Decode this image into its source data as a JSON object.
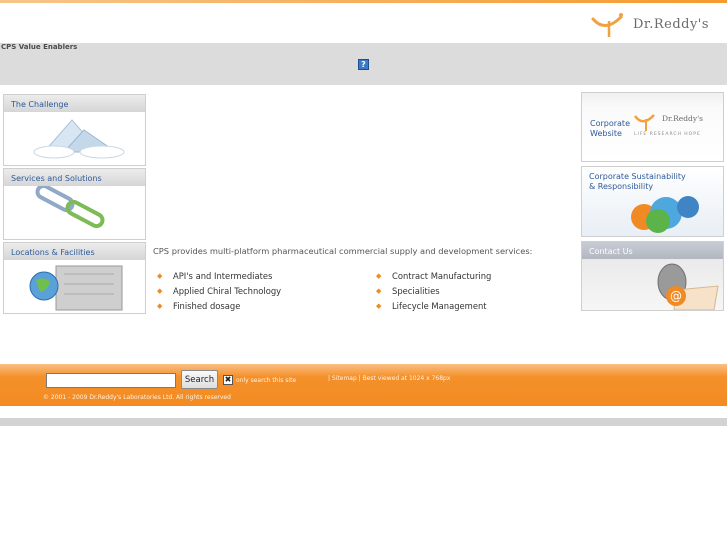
{
  "header": {
    "logo_text": "Dr.Reddy's",
    "band_label": "CPS Value Enablers",
    "help_glyph": "?"
  },
  "left_boxes": [
    {
      "title": "The Challenge",
      "icon": "mountain-cloud-icon"
    },
    {
      "title": "Services and Solutions",
      "icon": "chain-link-icon"
    },
    {
      "title": "Locations & Facilities",
      "icon": "globe-building-icon"
    }
  ],
  "main": {
    "intro": "CPS provides multi-platform pharmaceutical commercial supply and development services:",
    "services_col1": [
      "API's and Intermediates",
      "Applied Chiral Technology",
      "Finished dosage"
    ],
    "services_col2": [
      "Contract Manufacturing",
      "Specialities",
      "Lifecycle Management"
    ],
    "bullet": "◆"
  },
  "right_boxes": {
    "corporate": {
      "line1": "Corporate",
      "line2": "Website",
      "logo_text": "Dr.Reddy's",
      "tagline": "LIFE  RESEARCH  HOPE"
    },
    "sustainability": {
      "line1": "Corporate Sustainability",
      "line2": "& Responsibility"
    },
    "contact": {
      "title": "Contact Us"
    }
  },
  "footer": {
    "search_placeholder": "",
    "search_button": "Search",
    "checkbox_mark": "✖",
    "checkbox_label": "only search this site",
    "links": "| Sitemap | Best viewed at 1024 x 768px",
    "copyright": "© 2001 - 2009 Dr.Reddy's Laboratories Ltd. All rights reserved"
  },
  "colors": {
    "accent": "#f48b22",
    "link": "#2d5a9a",
    "band": "#dcdcdc"
  }
}
